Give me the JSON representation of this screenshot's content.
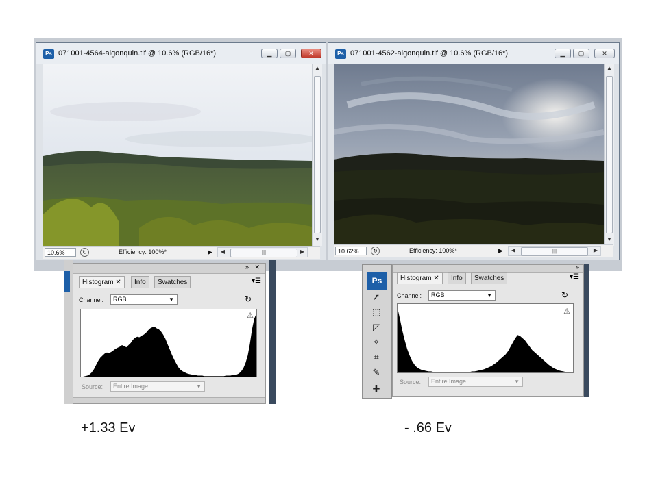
{
  "windows": [
    {
      "title": "071001-4564-algonquin.tif @ 10.6% (RGB/16*)",
      "zoom": "10.6%",
      "efficiency": "Efficiency: 100%*",
      "active": true
    },
    {
      "title": "071001-4562-algonquin.tif @ 10.6% (RGB/16*)",
      "zoom": "10.62%",
      "efficiency": "Efficiency: 100%*",
      "active": false
    }
  ],
  "panels": [
    {
      "tabs": [
        "Histogram",
        "Info",
        "Swatches"
      ],
      "channel_label": "Channel:",
      "channel_value": "RGB",
      "source_label": "Source:",
      "source_value": "Entire Image",
      "caption": "+1.33 Ev",
      "histogram": [
        0,
        0,
        1,
        2,
        4,
        8,
        14,
        22,
        30,
        36,
        40,
        44,
        46,
        45,
        47,
        50,
        53,
        55,
        57,
        60,
        58,
        56,
        60,
        64,
        70,
        74,
        76,
        75,
        78,
        80,
        83,
        88,
        92,
        94,
        95,
        92,
        90,
        86,
        80,
        72,
        62,
        52,
        42,
        33,
        25,
        18,
        13,
        10,
        8,
        6,
        5,
        4,
        3,
        3,
        2,
        2,
        2,
        1,
        1,
        1,
        1,
        1,
        1,
        1,
        1,
        1,
        1,
        2,
        2,
        2,
        3,
        3,
        4,
        6,
        10,
        16,
        26,
        40,
        62,
        90,
        110,
        120
      ]
    },
    {
      "tabs": [
        "Histogram",
        "Info",
        "Swatches"
      ],
      "channel_label": "Channel:",
      "channel_value": "RGB",
      "source_label": "Source:",
      "source_value": "Entire Image",
      "caption": "- .66 Ev",
      "histogram": [
        120,
        100,
        78,
        60,
        44,
        32,
        22,
        15,
        10,
        7,
        5,
        4,
        3,
        2,
        2,
        1,
        1,
        1,
        1,
        1,
        1,
        1,
        1,
        1,
        1,
        1,
        1,
        1,
        1,
        1,
        1,
        2,
        2,
        3,
        4,
        5,
        6,
        8,
        10,
        12,
        15,
        18,
        22,
        26,
        30,
        34,
        40,
        48,
        56,
        64,
        70,
        68,
        64,
        60,
        54,
        48,
        42,
        38,
        34,
        30,
        26,
        22,
        18,
        14,
        11,
        8,
        6,
        4,
        3,
        2,
        1,
        1,
        0,
        0
      ]
    }
  ],
  "toolbox": {
    "logo": "Ps"
  },
  "icons": {
    "ps_doc": "photoshop-doc-icon",
    "minimize": "minimize-icon",
    "maximize": "maximize-icon",
    "close": "close-icon",
    "refresh": "refresh-icon",
    "warning": "warning-icon",
    "menu": "panel-menu-icon"
  },
  "colors": {
    "ps_blue": "#1d5fa8",
    "close_red": "#c0392b"
  }
}
